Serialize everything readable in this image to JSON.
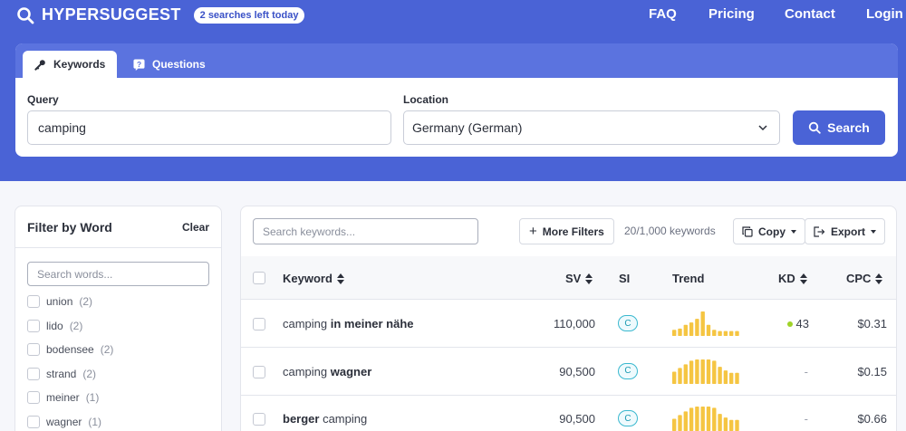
{
  "header": {
    "brand": "HYPERSUGGEST",
    "badge": "2 searches left today",
    "nav": [
      "FAQ",
      "Pricing",
      "Contact",
      "Login"
    ]
  },
  "search_card": {
    "tabs": [
      {
        "label": "Keywords",
        "icon": "key-icon",
        "active": true
      },
      {
        "label": "Questions",
        "icon": "question-icon",
        "active": false
      }
    ],
    "query_label": "Query",
    "query_value": "camping",
    "location_label": "Location",
    "location_value": "Germany (German)",
    "search_button": "Search"
  },
  "sidebar": {
    "title": "Filter by Word",
    "clear": "Clear",
    "search_placeholder": "Search words...",
    "words": [
      {
        "word": "union",
        "count": "(2)"
      },
      {
        "word": "lido",
        "count": "(2)"
      },
      {
        "word": "bodensee",
        "count": "(2)"
      },
      {
        "word": "strand",
        "count": "(2)"
      },
      {
        "word": "meiner",
        "count": "(1)"
      },
      {
        "word": "wagner",
        "count": "(1)"
      }
    ]
  },
  "table": {
    "search_placeholder": "Search keywords...",
    "more_filters": "More Filters",
    "count_text": "20/1,000 keywords",
    "copy": "Copy",
    "export": "Export",
    "columns": [
      "Keyword",
      "SV",
      "SI",
      "Trend",
      "KD",
      "CPC"
    ],
    "colors": {
      "trend": "#f5c542",
      "kd_easy": "#9fd327",
      "si": "#3ab8cf"
    },
    "rows": [
      {
        "kw_plain": "camping ",
        "kw_bold": "in meiner nähe",
        "bold_first": false,
        "sv": "110,000",
        "si": "C",
        "kd": "43",
        "cpc": "$0.31",
        "trend": [
          0.25,
          0.3,
          0.45,
          0.55,
          0.7,
          1.0,
          0.45,
          0.25,
          0.2,
          0.2,
          0.2,
          0.2
        ]
      },
      {
        "kw_plain": "camping ",
        "kw_bold": "wagner",
        "bold_first": false,
        "sv": "90,500",
        "si": "C",
        "kd": "-",
        "cpc": "$0.15",
        "trend": [
          0.5,
          0.65,
          0.8,
          0.95,
          1.0,
          1.0,
          1.0,
          0.95,
          0.7,
          0.55,
          0.45,
          0.45
        ]
      },
      {
        "kw_plain": " camping",
        "kw_bold": "berger",
        "bold_first": true,
        "sv": "90,500",
        "si": "C",
        "kd": "-",
        "cpc": "$0.66",
        "trend": [
          0.5,
          0.65,
          0.8,
          0.95,
          1.0,
          1.0,
          1.0,
          0.95,
          0.7,
          0.55,
          0.45,
          0.45
        ]
      }
    ]
  }
}
